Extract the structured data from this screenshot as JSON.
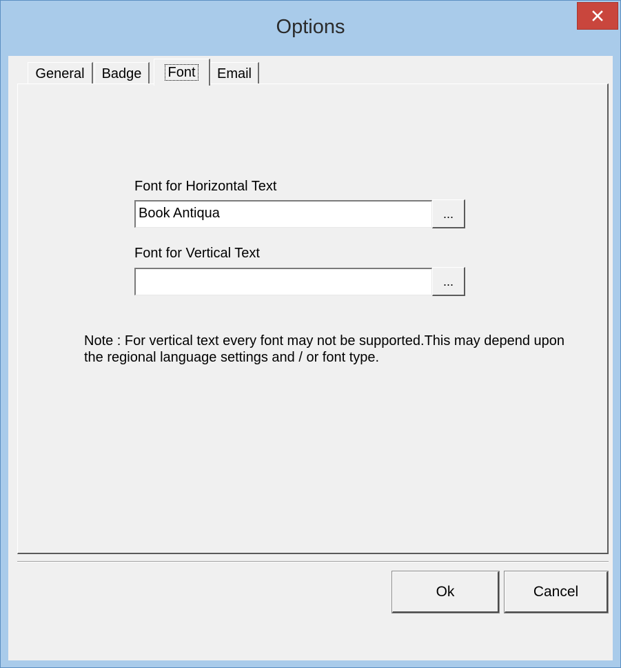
{
  "window": {
    "title": "Options",
    "close_label": "×"
  },
  "tabs": [
    {
      "label": "General"
    },
    {
      "label": "Badge"
    },
    {
      "label": "Font",
      "active": true
    },
    {
      "label": "Email"
    }
  ],
  "font_tab": {
    "horizontal_label": "Font for Horizontal Text",
    "horizontal_value": "Book Antiqua",
    "vertical_label": "Font for Vertical Text",
    "vertical_value": "",
    "browse_label": "...",
    "note": "Note : For vertical text every font may not be supported.This may depend upon the regional language settings and / or font type."
  },
  "buttons": {
    "ok": "Ok",
    "cancel": "Cancel"
  }
}
